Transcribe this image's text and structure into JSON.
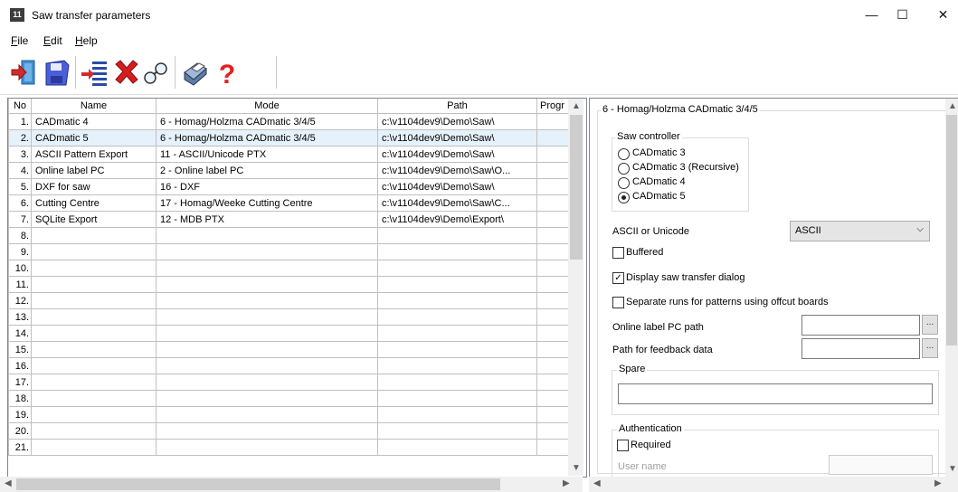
{
  "window": {
    "title": "Saw transfer parameters",
    "icon_text": "11",
    "controls": {
      "minimize": "—",
      "maximize": "☐",
      "close": "✕"
    }
  },
  "menu": [
    {
      "label": "File",
      "underline": "F",
      "rest": "ile"
    },
    {
      "label": "Edit",
      "underline": "E",
      "rest": "dit"
    },
    {
      "label": "Help",
      "underline": "H",
      "rest": "elp"
    }
  ],
  "toolbar": {
    "items": [
      "exit-icon",
      "save-icon",
      "insert-row-icon",
      "delete-icon",
      "find-icon",
      "print-icon",
      "help-icon"
    ],
    "help_glyph": "?"
  },
  "grid": {
    "headers": {
      "no": "No",
      "name": "Name",
      "mode": "Mode",
      "path": "Path",
      "prog": "Progr"
    },
    "rows": [
      {
        "no": "1.",
        "name": "CADmatic 4",
        "mode": "6 - Homag/Holzma CADmatic 3/4/5",
        "path": "c:\\v1104dev9\\Demo\\Saw\\"
      },
      {
        "no": "2.",
        "name": "CADmatic 5",
        "mode": "6 - Homag/Holzma CADmatic 3/4/5",
        "path": "c:\\v1104dev9\\Demo\\Saw\\"
      },
      {
        "no": "3.",
        "name": "ASCII Pattern Export",
        "mode": "11 - ASCII/Unicode PTX",
        "path": "c:\\v1104dev9\\Demo\\Saw\\"
      },
      {
        "no": "4.",
        "name": "Online label PC",
        "mode": "2 - Online label PC",
        "path": "c:\\v1104dev9\\Demo\\Saw\\O..."
      },
      {
        "no": "5.",
        "name": "DXF for saw",
        "mode": "16 - DXF",
        "path": "c:\\v1104dev9\\Demo\\Saw\\"
      },
      {
        "no": "6.",
        "name": "Cutting Centre",
        "mode": "17 - Homag/Weeke Cutting Centre",
        "path": "c:\\v1104dev9\\Demo\\Saw\\C..."
      },
      {
        "no": "7.",
        "name": "SQLite Export",
        "mode": "12 - MDB PTX",
        "path": "c:\\v1104dev9\\Demo\\Export\\"
      },
      {
        "no": "8.",
        "name": "",
        "mode": "",
        "path": ""
      },
      {
        "no": "9.",
        "name": "",
        "mode": "",
        "path": ""
      },
      {
        "no": "10.",
        "name": "",
        "mode": "",
        "path": ""
      },
      {
        "no": "11.",
        "name": "",
        "mode": "",
        "path": ""
      },
      {
        "no": "12.",
        "name": "",
        "mode": "",
        "path": ""
      },
      {
        "no": "13.",
        "name": "",
        "mode": "",
        "path": ""
      },
      {
        "no": "14.",
        "name": "",
        "mode": "",
        "path": ""
      },
      {
        "no": "15.",
        "name": "",
        "mode": "",
        "path": ""
      },
      {
        "no": "16.",
        "name": "",
        "mode": "",
        "path": ""
      },
      {
        "no": "17.",
        "name": "",
        "mode": "",
        "path": ""
      },
      {
        "no": "18.",
        "name": "",
        "mode": "",
        "path": ""
      },
      {
        "no": "19.",
        "name": "",
        "mode": "",
        "path": ""
      },
      {
        "no": "20.",
        "name": "",
        "mode": "",
        "path": ""
      },
      {
        "no": "21.",
        "name": "",
        "mode": "",
        "path": ""
      }
    ],
    "selected_row": 1
  },
  "panel": {
    "mode_group_title": "6 - Homag/Holzma CADmatic 3/4/5",
    "saw_controller": {
      "title": "Saw controller",
      "options": [
        "CADmatic 3",
        "CADmatic 3 (Recursive)",
        "CADmatic 4",
        "CADmatic 5"
      ],
      "selected": 3
    },
    "encoding": {
      "label": "ASCII or Unicode",
      "value": "ASCII"
    },
    "buffered": {
      "label": "Buffered",
      "checked": false
    },
    "display_dialog": {
      "label": "Display saw transfer dialog",
      "checked": true
    },
    "separate_runs": {
      "label": "Separate runs for patterns using offcut boards",
      "checked": false
    },
    "online_label_path": {
      "label": "Online label PC path",
      "value": ""
    },
    "feedback_path": {
      "label": "Path for feedback data",
      "value": ""
    },
    "browse_label": "...",
    "spare": {
      "title": "Spare",
      "value": ""
    },
    "authentication": {
      "title": "Authentication",
      "required_label": "Required",
      "required": false,
      "user_name_label": "User name"
    }
  },
  "colors": {
    "selected_row": "#e5f1fb",
    "scroll_track": "#f0f0f0",
    "scroll_thumb": "#cdcdcd",
    "border": "#828790"
  }
}
